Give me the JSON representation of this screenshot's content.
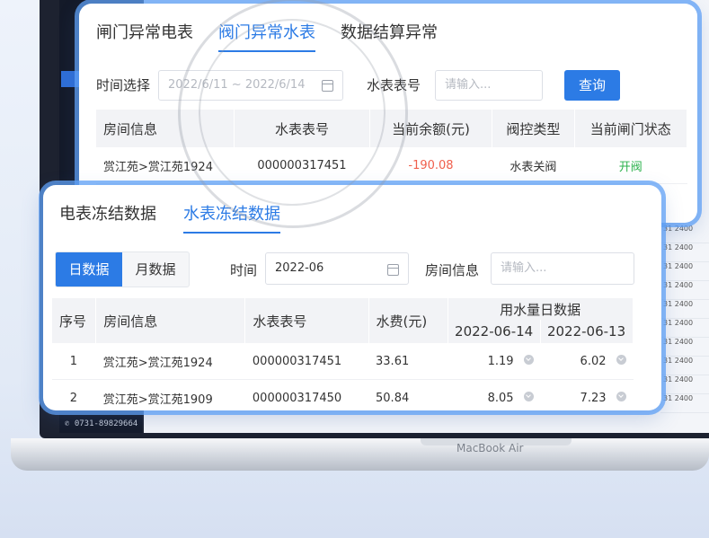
{
  "phone": "0731-89829664",
  "laptop_brand": "MacBook Air",
  "grid_values": [
    "31  2400",
    "31  2400",
    "31  2400",
    "31  2400",
    "31  2400",
    "31  2400",
    "31  2400",
    "31  2400",
    "31  2400",
    "31  2400"
  ],
  "top_card": {
    "tabs": [
      "闸门异常电表",
      "阀门异常水表",
      "数据结算异常"
    ],
    "active_tab": 1,
    "time_label": "时间选择",
    "date_range": "2022/6/11 ~ 2022/6/14",
    "meter_label": "水表表号",
    "meter_placeholder": "请输入...",
    "query_button": "查询",
    "columns": [
      "房间信息",
      "水表表号",
      "当前余额(元)",
      "阀控类型",
      "当前闸门状态"
    ],
    "rows": [
      {
        "room": "赏江苑>赏江苑1924",
        "meter": "000000317451",
        "balance": "-190.08",
        "valve": "水表关阀",
        "status": "开阀"
      }
    ]
  },
  "bottom_card": {
    "tabs": [
      "电表冻结数据",
      "水表冻结数据"
    ],
    "active_tab": 1,
    "seg_day": "日数据",
    "seg_month": "月数据",
    "time_label": "时间",
    "time_value": "2022-06",
    "room_label": "房间信息",
    "room_placeholder": "请输入...",
    "columns": {
      "index": "序号",
      "room": "房间信息",
      "meter": "水表表号",
      "fee": "水费(元)",
      "usage_group": "用水量日数据",
      "date1": "2022-06-14",
      "date2": "2022-06-13"
    },
    "rows": [
      {
        "index": "1",
        "room": "赏江苑>赏江苑1924",
        "meter": "000000317451",
        "fee": "33.61",
        "d1": "1.19",
        "d2": "6.02"
      },
      {
        "index": "2",
        "room": "赏江苑>赏江苑1909",
        "meter": "000000317450",
        "fee": "50.84",
        "d1": "8.05",
        "d2": "7.23"
      }
    ]
  },
  "colors": {
    "accent": "#2c7be5",
    "negative": "#f0604d",
    "open": "#2bb24c"
  }
}
